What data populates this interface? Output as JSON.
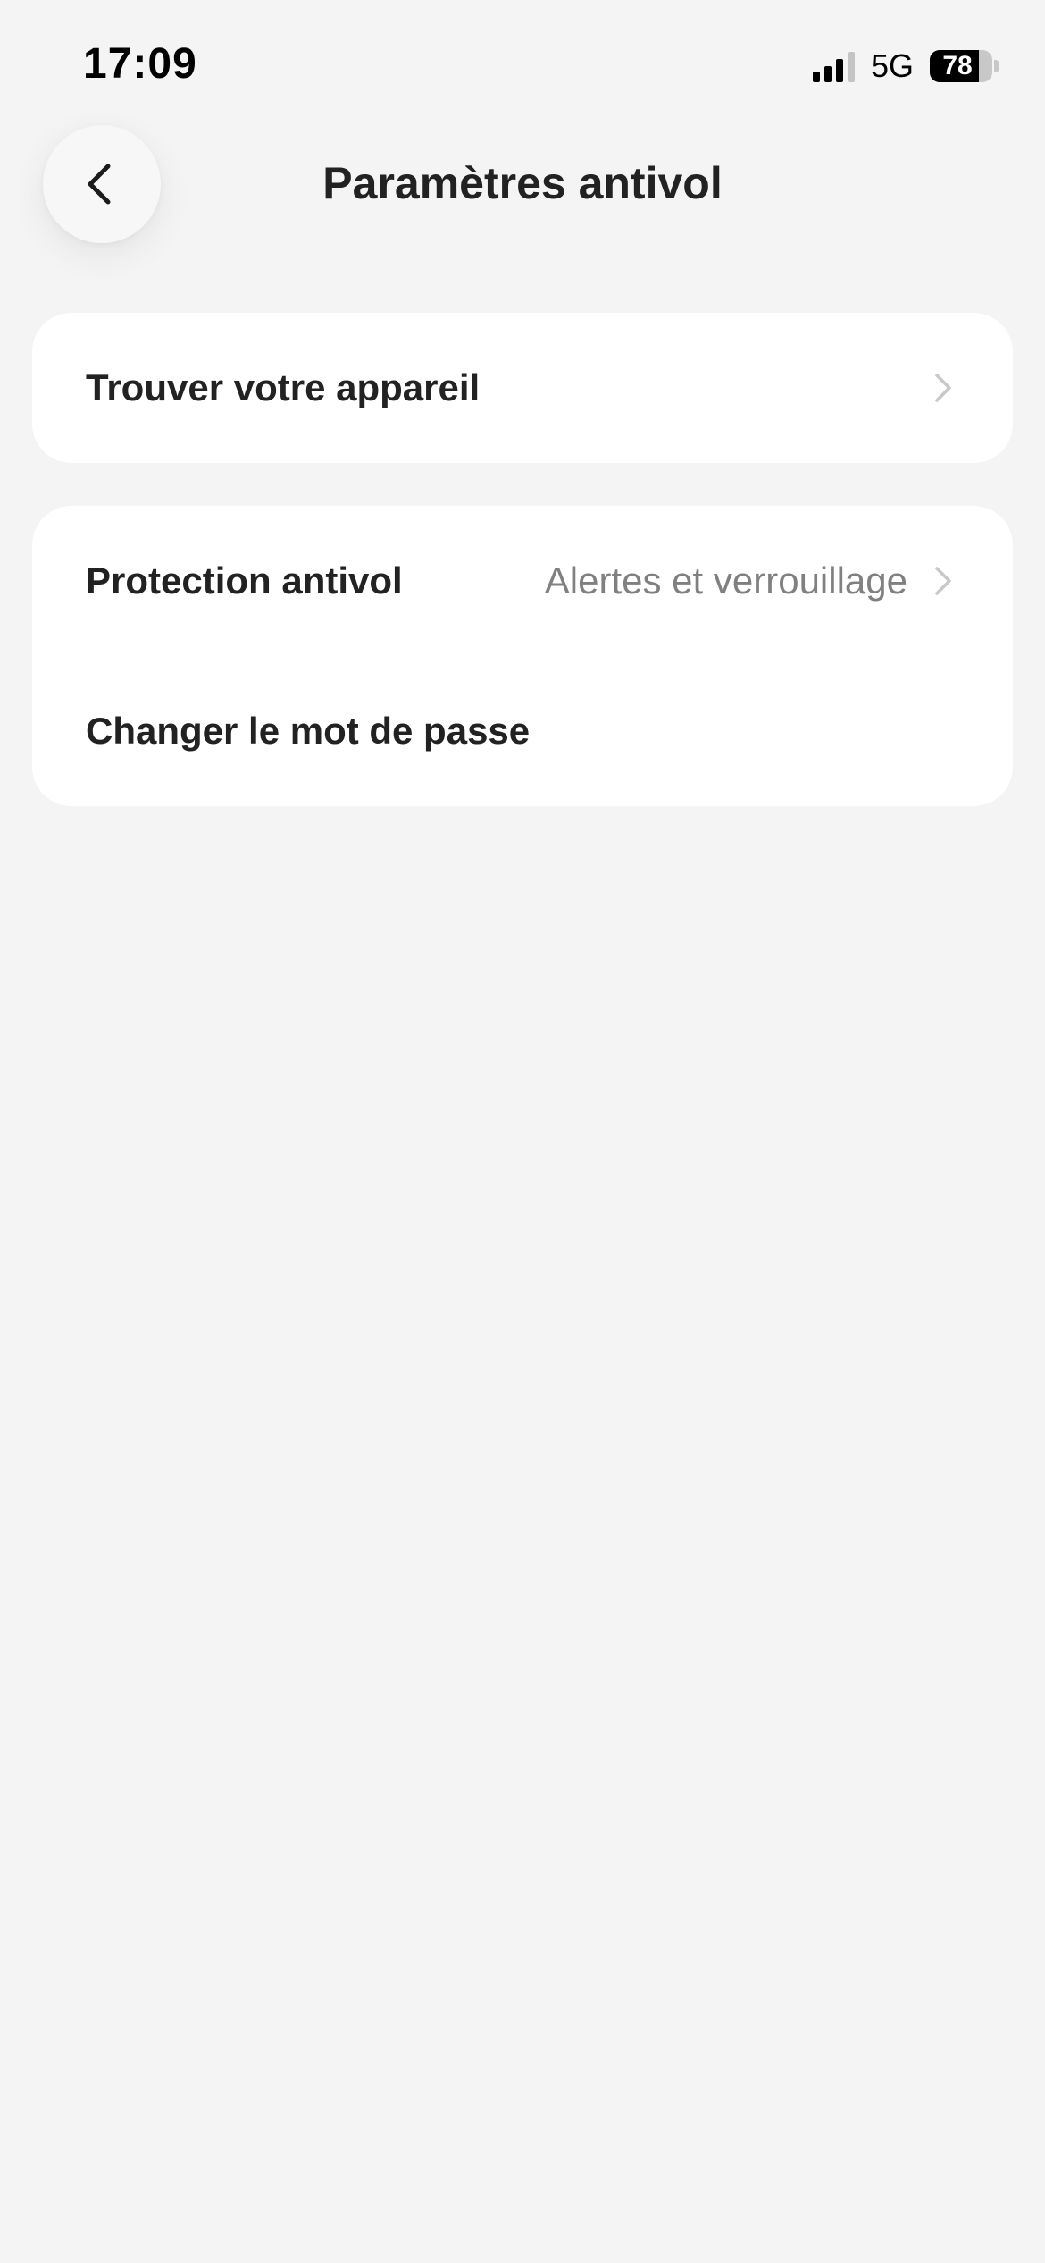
{
  "status_bar": {
    "time": "17:09",
    "network": "5G",
    "battery": "78",
    "battery_level": 0.78,
    "signal_bars_active": 3,
    "signal_bars_total": 4
  },
  "header": {
    "back_icon": "chevron-left-icon",
    "title": "Paramètres antivol"
  },
  "settings": {
    "find_device": {
      "label": "Trouver votre appareil",
      "icon": "chevron-right-icon"
    },
    "antitheft_protection": {
      "label": "Protection antivol",
      "value": "Alertes et verrouillage",
      "icon": "chevron-right-icon"
    },
    "change_password": {
      "label": "Changer le mot de passe"
    }
  },
  "colors": {
    "background": "#f4f4f4",
    "card": "#ffffff",
    "primary_text": "#222222",
    "secondary_text": "#808080",
    "chevron": "#c7c7cc"
  }
}
